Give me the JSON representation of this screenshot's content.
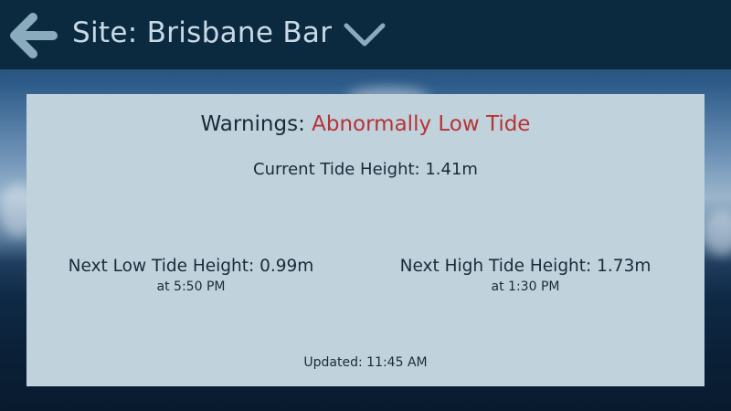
{
  "header": {
    "back_icon": "arrow-left-icon",
    "site_title": "Site: Brisbane Bar",
    "dropdown_icon": "chevron-down-icon",
    "color": "#0b2a40"
  },
  "card": {
    "warning_label": "Warnings:",
    "warning_value": "Abnormally Low Tide",
    "warning_color": "#b83236",
    "current_tide": "Current Tide Height: 1.41m",
    "next_low": {
      "height": "Next Low Tide Height: 0.99m",
      "time": "at 5:50 PM"
    },
    "next_high": {
      "height": "Next High Tide Height: 1.73m",
      "time": "at 1:30 PM"
    },
    "updated": "Updated: 11:45 AM"
  }
}
